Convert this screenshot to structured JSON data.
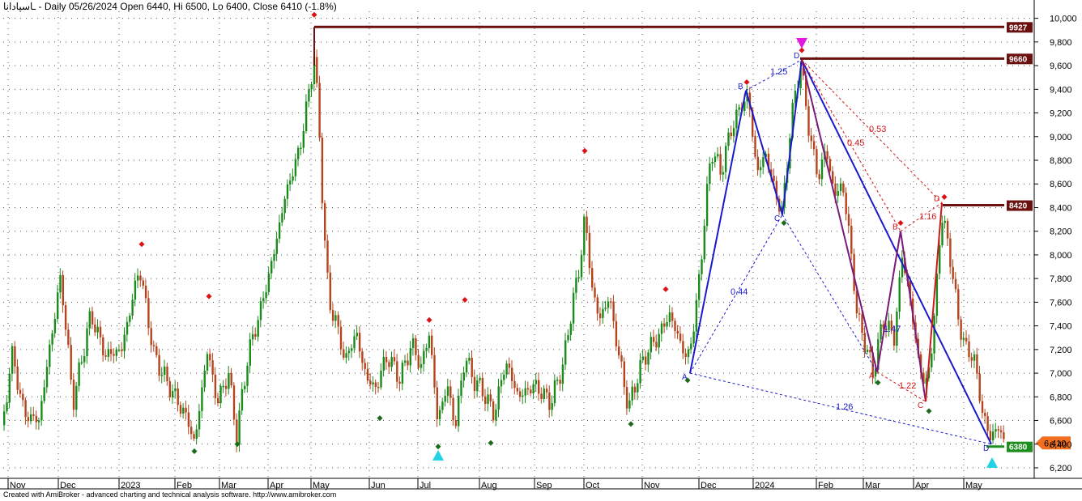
{
  "header": {
    "symbol": "ـاسپادانا",
    "text": " - Daily 05/26/2024 Open 6440, Hi 6500, Lo 6400, Close 6410 (-1.8%)"
  },
  "footer": {
    "text": "Created with AmiBroker - advanced charting and technical analysis software. http://www.amibroker.com"
  },
  "chart_data": {
    "type": "candlestick",
    "ylim": [
      6200,
      10000
    ],
    "y_ticks": [
      "6,200",
      "6,400",
      "6,600",
      "6,800",
      "7,000",
      "7,200",
      "7,400",
      "7,600",
      "7,800",
      "8,000",
      "8,200",
      "8,400",
      "8,600",
      "8,800",
      "9,000",
      "9,200",
      "9,400",
      "9,600",
      "9,800",
      "10,000"
    ],
    "x_ticks": [
      "Nov",
      "Dec",
      "2023",
      "Feb",
      "Mar",
      "Apr",
      "May",
      "Jun",
      "Jul",
      "Aug",
      "Sep",
      "Oct",
      "Nov",
      "Dec",
      "2024",
      "Feb",
      "Mar",
      "Apr",
      "May"
    ],
    "last_price_label": "6,410",
    "levels": [
      {
        "label": "9927",
        "value": 9927,
        "start": "May"
      },
      {
        "label": "9660",
        "value": 9660,
        "start": "2024"
      },
      {
        "label": "8420",
        "value": 8420,
        "start": "Apr"
      },
      {
        "label": "6380",
        "value": 6380,
        "start": "May"
      }
    ],
    "colors": {
      "up": "#1a8a1a",
      "down": "#b5441c",
      "level": "#6b0f0f",
      "level_green": "#1e8f1e",
      "pattern_blue": "#1a1acc",
      "pattern_purple": "#7a1a7a",
      "pattern_red": "#d01818",
      "price_tag": "#f07020",
      "cyan": "#22d3e6",
      "magenta": "#e018e0"
    },
    "pattern_points": [
      {
        "label": "A",
        "value": 7000
      },
      {
        "label": "B",
        "value": 9390
      },
      {
        "label": "C",
        "value": 8340
      },
      {
        "label": "D",
        "value": 9650
      },
      {
        "label": "A",
        "value": 7010
      },
      {
        "label": "B",
        "value": 8200
      },
      {
        "label": "C",
        "value": 6760
      },
      {
        "label": "D",
        "value": 8440
      },
      {
        "label": "D",
        "value": 6400
      }
    ],
    "ratios": [
      "1.25",
      "0.44",
      "0.53",
      "0.45",
      "1.16",
      "1.47",
      "1.22",
      "1.26"
    ]
  }
}
